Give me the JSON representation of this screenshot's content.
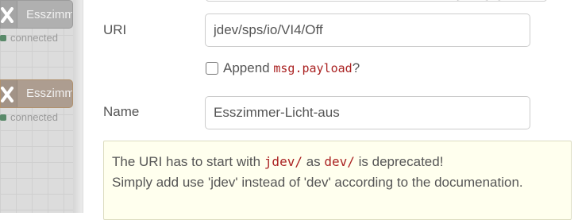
{
  "canvas": {
    "nodes": [
      {
        "label": "Esszimmer",
        "status": "connected"
      },
      {
        "label": "Esszimmer",
        "status": "connected"
      }
    ]
  },
  "form": {
    "uri": {
      "label": "URI",
      "value": "jdev/sps/io/VI4/Off"
    },
    "append": {
      "text": "Append",
      "code": "msg.payload",
      "suffix": "?",
      "checked": false
    },
    "name": {
      "label": "Name",
      "value": "Esszimmer-Licht-aus"
    }
  },
  "tip": {
    "line1_a": "The URI has to start with ",
    "line1_code1": "jdev/",
    "line1_b": " as ",
    "line1_code2": "dev/",
    "line1_c": " is deprecated!",
    "line2": "Simply add use 'jdev' instead of 'dev' according to the documenation."
  },
  "colors": {
    "code": "#aa2222",
    "tip_background": "#ffffee",
    "selected_node_border": "#b0916e",
    "connected_dot": "#5a8a6a"
  }
}
